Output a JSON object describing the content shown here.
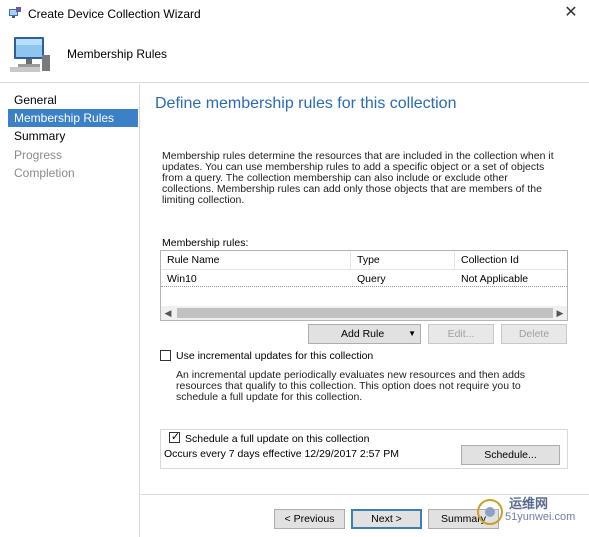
{
  "window": {
    "title": "Create Device Collection Wizard",
    "close_glyph": "✕"
  },
  "header": {
    "title": "Membership Rules"
  },
  "sidebar": {
    "items": [
      {
        "label": "General",
        "state": "normal"
      },
      {
        "label": "Membership Rules",
        "state": "active"
      },
      {
        "label": "Summary",
        "state": "normal"
      },
      {
        "label": "Progress",
        "state": "disabled"
      },
      {
        "label": "Completion",
        "state": "disabled"
      }
    ]
  },
  "main": {
    "heading": "Define membership rules for this collection",
    "description": "Membership rules determine the resources that are included in the collection when it updates. You can use membership rules to add a specific object or a set of objects from a query. The collection membership can also include or exclude other collections. Membership rules can add only those objects that are members of the limiting collection.",
    "rules_label": "Membership rules:",
    "table": {
      "columns": [
        "Rule Name",
        "Type",
        "Collection Id"
      ],
      "rows": [
        [
          "Win10",
          "Query",
          "Not Applicable"
        ]
      ]
    },
    "buttons": {
      "add_rule": "Add Rule",
      "edit": "Edit...",
      "delete": "Delete"
    },
    "incremental": {
      "checked": false,
      "label": "Use incremental updates for this collection",
      "help": "An incremental update periodically evaluates new resources and then adds resources that qualify to this collection. This option does not require you to schedule a full update for this collection."
    },
    "schedule": {
      "checked": true,
      "checkbox_glyph": "✓",
      "label": "Schedule a full update on this collection",
      "summary": "Occurs every 7 days effective 12/29/2017 2:57 PM",
      "button": "Schedule..."
    }
  },
  "footer": {
    "previous": "< Previous",
    "next": "Next >",
    "summary": "Summary"
  },
  "watermark": {
    "line1": "运维网",
    "line2": "51yunwei.com"
  },
  "colors": {
    "accent": "#2a6bb5",
    "active_nav": "#3c80c8"
  }
}
